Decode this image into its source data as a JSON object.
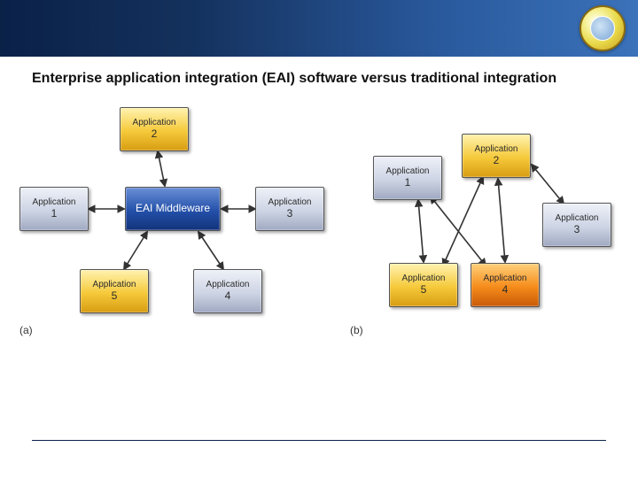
{
  "header": {
    "logo_name": "university-seal"
  },
  "title": "Enterprise application integration (EAI) software versus traditional integration",
  "diagram_a": {
    "label": "(a)",
    "hub": "EAI Middleware",
    "nodes": {
      "app1": {
        "line1": "Application",
        "line2": "1"
      },
      "app2": {
        "line1": "Application",
        "line2": "2"
      },
      "app3": {
        "line1": "Application",
        "line2": "3"
      },
      "app4": {
        "line1": "Application",
        "line2": "4"
      },
      "app5": {
        "line1": "Application",
        "line2": "5"
      }
    }
  },
  "diagram_b": {
    "label": "(b)",
    "nodes": {
      "app1": {
        "line1": "Application",
        "line2": "1"
      },
      "app2": {
        "line1": "Application",
        "line2": "2"
      },
      "app3": {
        "line1": "Application",
        "line2": "3"
      },
      "app4": {
        "line1": "Application",
        "line2": "4"
      },
      "app5": {
        "line1": "Application",
        "line2": "5"
      }
    }
  }
}
